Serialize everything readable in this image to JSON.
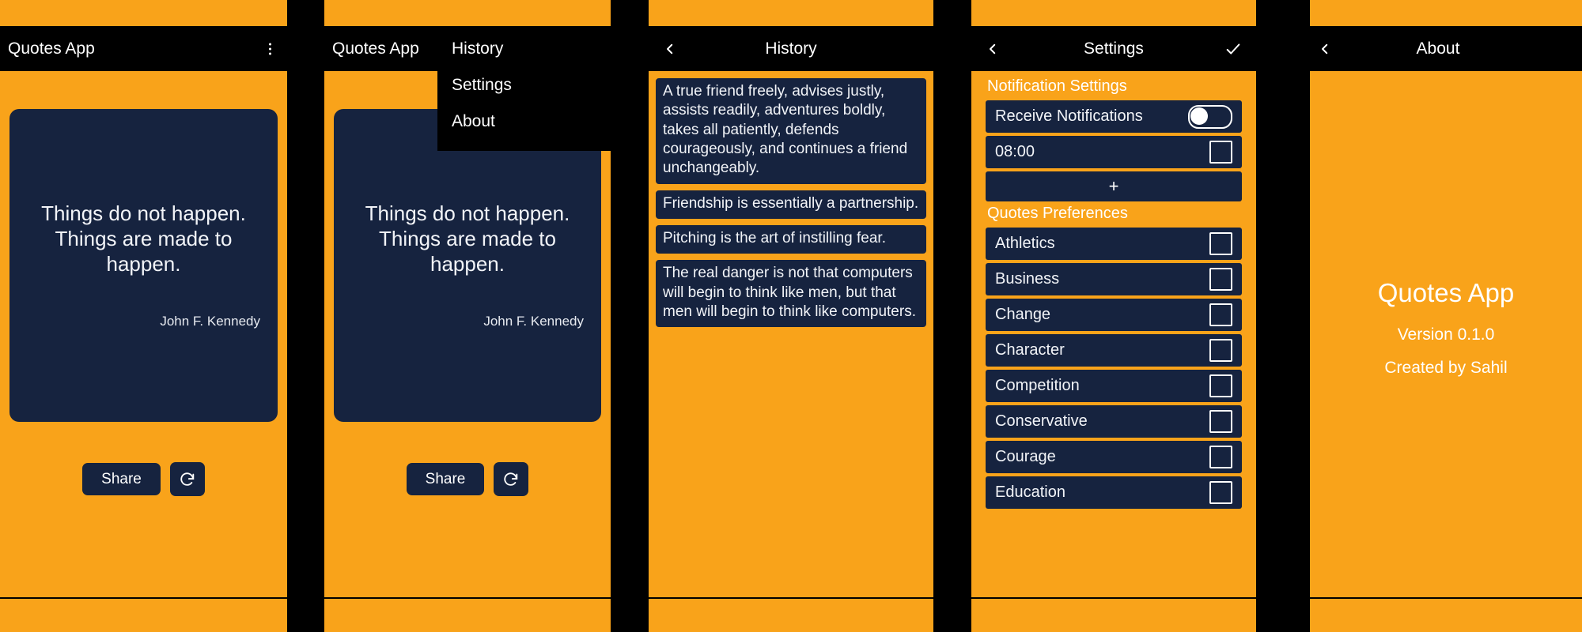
{
  "theme": {
    "orange": "#F9A31A",
    "card": "#16233F",
    "bar": "#000000",
    "text": "#FFFFFF"
  },
  "panels": {
    "home": {
      "app_title": "Quotes App",
      "menu_icon": "kebab-menu-icon",
      "quote_text": "Things do not happen.\nThings are made to happen.",
      "quote_author": "John F. Kennedy",
      "share_label": "Share",
      "refresh_icon": "refresh-icon"
    },
    "home_menu": {
      "app_title": "Quotes App",
      "quote_text": "Things do not happen.\nThings are made to happen.",
      "quote_author": "John F. Kennedy",
      "share_label": "Share",
      "refresh_icon": "refresh-icon",
      "menu_items": [
        {
          "label": "History"
        },
        {
          "label": "Settings"
        },
        {
          "label": "About"
        }
      ]
    },
    "history": {
      "title": "History",
      "back_icon": "chevron-left-icon",
      "items": [
        {
          "text": "A true friend freely, advises justly, assists readily, adventures boldly, takes all patiently, defends courageously, and continues a friend unchangeably."
        },
        {
          "text": "Friendship is essentially a partnership."
        },
        {
          "text": "Pitching is the art of instilling fear."
        },
        {
          "text": "The real danger is not that computers will begin to think like men, but that men will begin to think like computers."
        }
      ]
    },
    "settings": {
      "title": "Settings",
      "back_icon": "chevron-left-icon",
      "confirm_icon": "check-icon",
      "notification_section": "Notification Settings",
      "receive_notifications_label": "Receive Notifications",
      "receive_notifications_value": "off",
      "alarm_time": "08:00",
      "alarm_checked": "false",
      "add_label": "+",
      "preferences_section": "Quotes Preferences",
      "preferences": [
        {
          "label": "Athletics",
          "checked": "false"
        },
        {
          "label": "Business",
          "checked": "false"
        },
        {
          "label": "Change",
          "checked": "false"
        },
        {
          "label": "Character",
          "checked": "false"
        },
        {
          "label": "Competition",
          "checked": "false"
        },
        {
          "label": "Conservative",
          "checked": "false"
        },
        {
          "label": "Courage",
          "checked": "false"
        },
        {
          "label": "Education",
          "checked": "false"
        }
      ]
    },
    "about": {
      "title": "About",
      "back_icon": "chevron-left-icon",
      "app_name": "Quotes App",
      "version": "Version 0.1.0",
      "credit": "Created by Sahil"
    }
  }
}
